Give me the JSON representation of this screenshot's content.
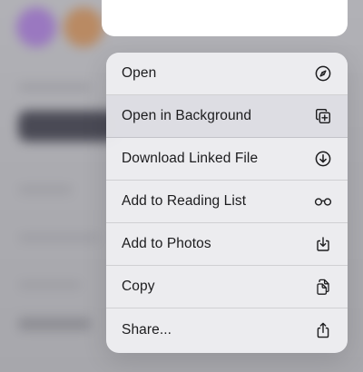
{
  "menu": {
    "items": [
      {
        "label": "Open",
        "icon": "compass-icon"
      },
      {
        "label": "Open in Background",
        "icon": "plus-square-on-square-icon"
      },
      {
        "label": "Download Linked File",
        "icon": "download-circle-icon"
      },
      {
        "label": "Add to Reading List",
        "icon": "eyeglasses-icon"
      },
      {
        "label": "Add to Photos",
        "icon": "save-to-photos-icon"
      },
      {
        "label": "Copy",
        "icon": "copy-docs-icon"
      },
      {
        "label": "Share...",
        "icon": "share-icon"
      }
    ]
  },
  "colors": {
    "menu_background": "#eeeef1",
    "text": "#1c1c1e",
    "separator": "#c6c6cb"
  }
}
